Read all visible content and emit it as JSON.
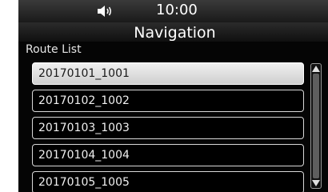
{
  "status_bar": {
    "time": "10:00",
    "volume_icon": "volume-icon"
  },
  "header": {
    "title": "Navigation"
  },
  "section": {
    "label": "Route List"
  },
  "routes": [
    {
      "label": "20170101_1001",
      "selected": true
    },
    {
      "label": "20170102_1002",
      "selected": false
    },
    {
      "label": "20170103_1003",
      "selected": false
    },
    {
      "label": "20170104_1004",
      "selected": false
    },
    {
      "label": "20170105_1005",
      "selected": false
    }
  ],
  "scrollbar": {
    "up_icon": "chevron-up-icon",
    "down_icon": "chevron-down-icon"
  },
  "colors": {
    "background": "#050505",
    "text": "#ffffff",
    "selected_item": "#dcdcdc",
    "item_border": "#d8d8d8"
  }
}
